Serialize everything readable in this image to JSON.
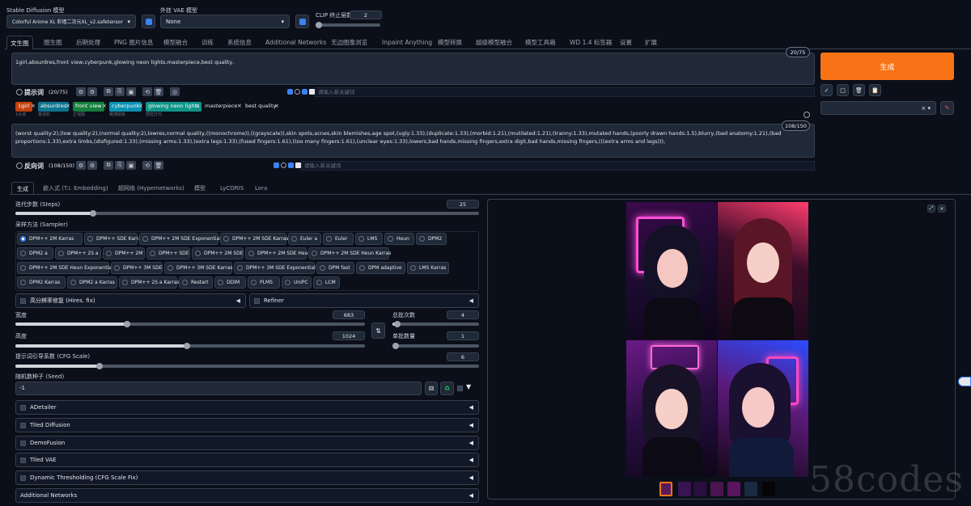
{
  "top": {
    "sd_model_label": "Stable Diffusion 模型",
    "sd_model_value": "Colorful Anime XL 彩墙二次元XL_v2.safetensor",
    "vae_label": "外挂 VAE 模型",
    "vae_value": "None",
    "clip_label": "CLIP 终止层数",
    "clip_value": "2"
  },
  "tabs": [
    "文生图",
    "图生图",
    "后期处理",
    "PNG 图片信息",
    "模型融合",
    "训练",
    "系统信息",
    "Additional Networks",
    "无边图像浏览",
    "Inpaint Anything",
    "模型转换",
    "超级模型融合",
    "模型工具箱",
    "WD 1.4 标签器",
    "设置",
    "扩展"
  ],
  "prompt": {
    "text": "1girl,absurdres,front view,cyberpunk,glowing neon lights,masterpiece,best quality,",
    "count": "20/75",
    "label": "提示词",
    "label_count": "(20/75)",
    "keyword_placeholder": "请输入新关键词",
    "tags": [
      "1girl",
      "absurdres",
      "front view",
      "cyberpunk",
      "glowing neon lights",
      "masterpiece",
      "best quality"
    ],
    "tag_translations": [
      "1女孩",
      "荒谬的",
      "正视图",
      "赛博朋克",
      "霓虹灯光"
    ]
  },
  "negative": {
    "text": "(worst quality:2),(low quality:2),(normal quality:2),lowres,normal quality,((monochrome)),((grayscale)),skin spots,acnes,skin blemishes,age spot,(ugly:1.33),(duplicate:1.33),(morbid:1.21),(mutilated:1.21),(tranny:1.33),mutated hands,(poorly drawn hands:1.5),blurry,(bad anatomy:1.21),(bad proportions:1.33),extra limbs,(disfigured:1.33),(missing arms:1.33),(extra legs:1.33),(fused fingers:1.61),(too many fingers:1.61),(unclear eyes:1.33),lowers,bad hands,missing fingers,extra digit,bad hands,missing fingers,(((extra arms and legs))),",
    "count": "108/150",
    "label": "反向词",
    "label_count": "(108/150)",
    "keyword_placeholder": "请输入新关键词"
  },
  "generate_label": "生成",
  "subtabs": [
    "生成",
    "嵌入式 (T.I. Embedding)",
    "超网络 (Hypernetworks)",
    "模型",
    "LyCORIS",
    "Lora"
  ],
  "steps": {
    "label": "迭代步数 (Steps)",
    "value": "25"
  },
  "sampler": {
    "label": "采样方法 (Sampler)",
    "options": [
      "DPM++ 2M Karras",
      "DPM++ SDE Karras",
      "DPM++ 2M SDE Exponential",
      "DPM++ 2M SDE Karras",
      "Euler a",
      "Euler",
      "LMS",
      "Heun",
      "DPM2",
      "DPM2 a",
      "DPM++ 2S a",
      "DPM++ 2M",
      "DPM++ SDE",
      "DPM++ 2M SDE",
      "DPM++ 2M SDE Heun",
      "DPM++ 2M SDE Heun Karras",
      "DPM++ 2M SDE Heun Exponential",
      "DPM++ 3M SDE",
      "DPM++ 3M SDE Karras",
      "DPM++ 3M SDE Exponential",
      "DPM fast",
      "DPM adaptive",
      "LMS Karras",
      "DPM2 Karras",
      "DPM2 a Karras",
      "DPM++ 2S a Karras",
      "Restart",
      "DDIM",
      "PLMS",
      "UniPC",
      "LCM"
    ],
    "selected": "DPM++ 2M Karras"
  },
  "hires": "高分辨率修复 (Hires. fix)",
  "refiner": "Refiner",
  "width": {
    "label": "宽度",
    "value": "683"
  },
  "height": {
    "label": "高度",
    "value": "1024"
  },
  "batch_count": {
    "label": "总批次数",
    "value": "4"
  },
  "batch_size": {
    "label": "单批数量",
    "value": "1"
  },
  "cfg": {
    "label": "提示词引导系数 (CFG Scale)",
    "value": "6"
  },
  "seed": {
    "label": "随机数种子 (Seed)",
    "value": "-1"
  },
  "accordions": [
    "ADetailer",
    "Tiled Diffusion",
    "DemoFusion",
    "Tiled VAE",
    "Dynamic Thresholding (CFG Scale Fix)",
    "Additional Networks"
  ],
  "watermark": "58codes",
  "colors": {
    "accent": "#f97316",
    "tab_blue": "#3b82f6",
    "bg": "#0b0f19"
  }
}
